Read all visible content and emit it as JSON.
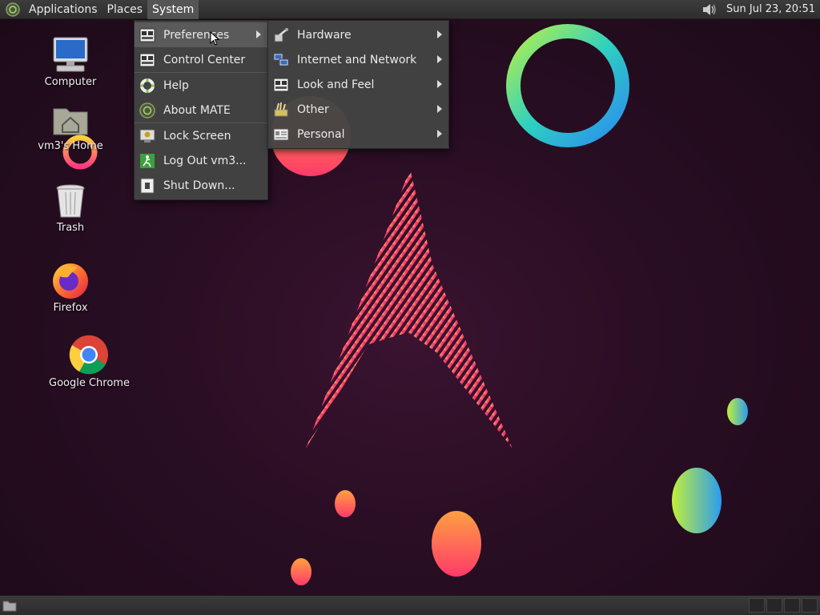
{
  "top_panel": {
    "menus": [
      "Applications",
      "Places",
      "System"
    ],
    "clock": "Sun Jul 23, 20:51",
    "volume_icon": "speaker-icon"
  },
  "desktop_icons": [
    {
      "label": "Computer",
      "icon": "computer-icon"
    },
    {
      "label": "vm3's Home",
      "icon": "home-folder-icon"
    },
    {
      "label": "Trash",
      "icon": "trash-icon"
    },
    {
      "label": "Firefox",
      "icon": "firefox-icon"
    },
    {
      "label": "Google Chrome",
      "icon": "chrome-icon"
    }
  ],
  "system_menu": {
    "items": [
      {
        "label": "Preferences",
        "icon": "preferences-icon",
        "submenu": true
      },
      {
        "label": "Control Center",
        "icon": "control-center-icon"
      },
      {
        "label": "Help",
        "icon": "help-icon"
      },
      {
        "label": "About MATE",
        "icon": "mate-icon"
      },
      {
        "label": "Lock Screen",
        "icon": "lock-screen-icon"
      },
      {
        "label": "Log Out vm3...",
        "icon": "logout-icon"
      },
      {
        "label": "Shut Down...",
        "icon": "shutdown-icon"
      }
    ]
  },
  "preferences_submenu": {
    "items": [
      {
        "label": "Hardware",
        "icon": "hardware-icon"
      },
      {
        "label": "Internet and Network",
        "icon": "network-icon"
      },
      {
        "label": "Look and Feel",
        "icon": "look-and-feel-icon"
      },
      {
        "label": "Other",
        "icon": "other-icon"
      },
      {
        "label": "Personal",
        "icon": "personal-icon"
      }
    ]
  },
  "colors": {
    "wallpaper": "#2a0e24",
    "panel": "#333333",
    "menu": "#444444",
    "highlight": "#5a5a5a"
  }
}
